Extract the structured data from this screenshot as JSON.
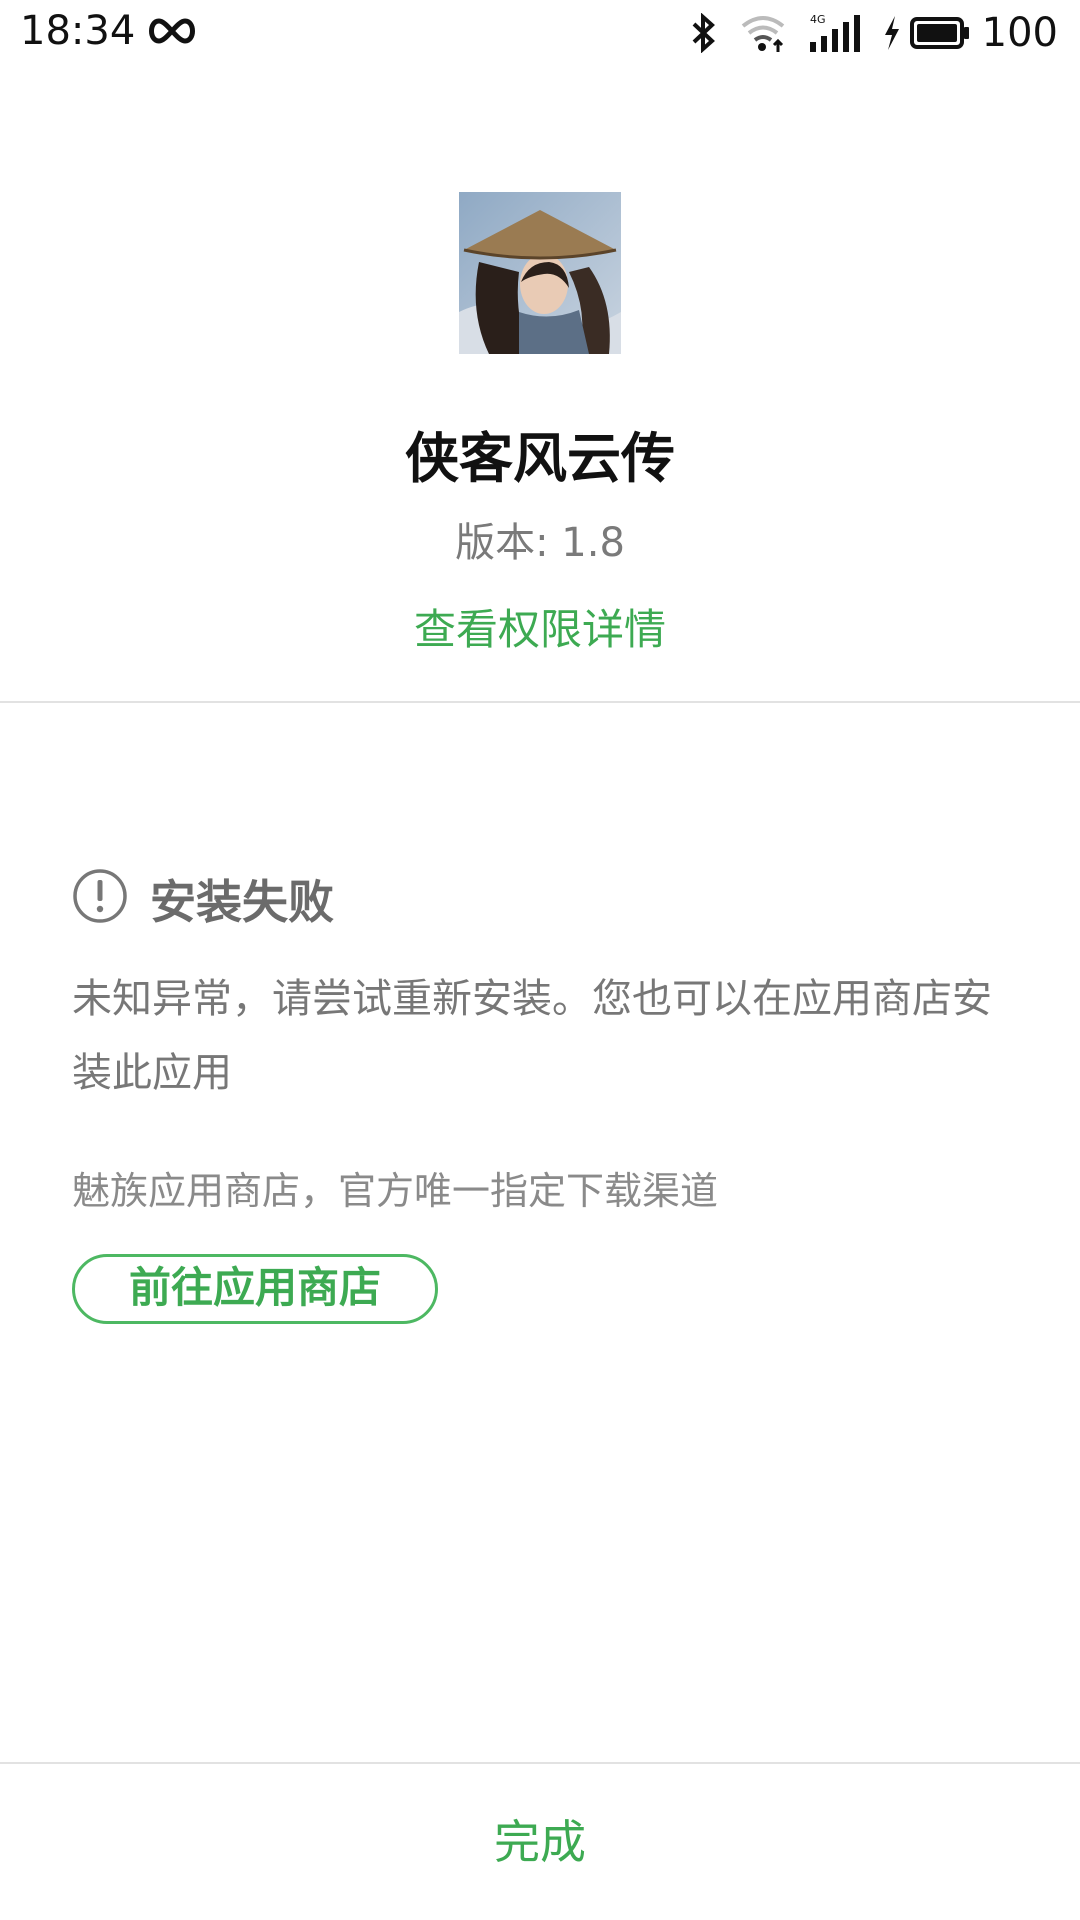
{
  "status_bar": {
    "time": "18:34",
    "battery": "100",
    "icons": [
      "infinity-icon",
      "bluetooth-icon",
      "wifi-icon",
      "signal-4g-icon",
      "charging-icon",
      "battery-icon"
    ]
  },
  "app": {
    "icon": "app-icon-game-character",
    "name": "侠客风云传",
    "version": "版本: 1.8",
    "permissions_link": "查看权限详情"
  },
  "install_result": {
    "icon": "exclamation-circle-icon",
    "title": "安装失败",
    "message": "未知异常，请尝试重新安装。您也可以在应用商店安装此应用",
    "store_note": "魅族应用商店，官方唯一指定下载渠道",
    "store_button": "前往应用商店"
  },
  "footer": {
    "done_label": "完成"
  },
  "colors": {
    "accent": "#3daa52",
    "muted_text": "#777777",
    "divider": "#e2e2e2"
  }
}
